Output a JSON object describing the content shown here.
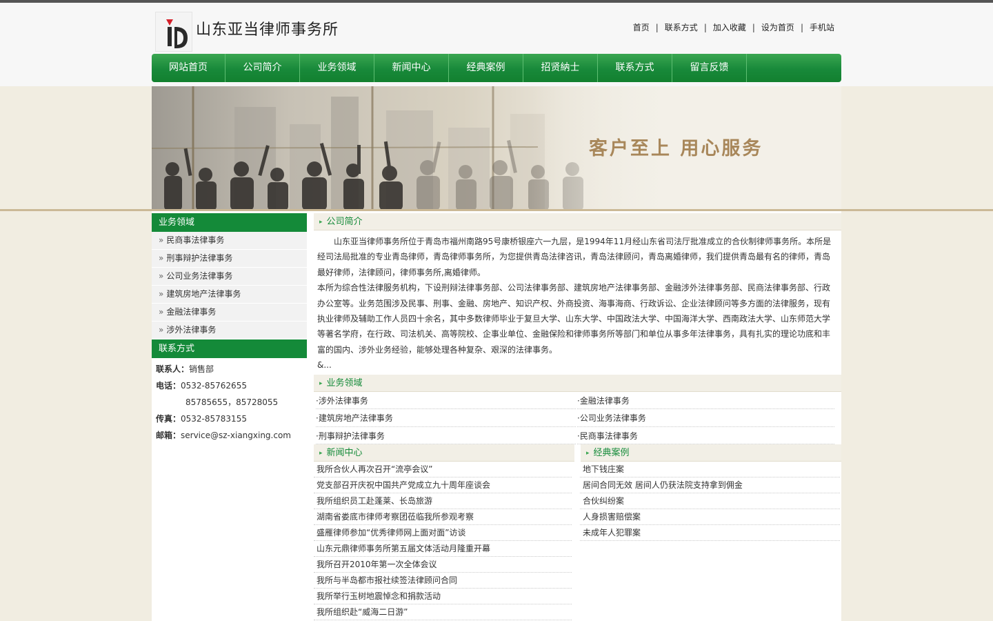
{
  "site": {
    "title": "山东亚当律师事务所",
    "colors": {
      "nav_green": "#148a39",
      "slogan_gold": "#a8875a",
      "page_bg": "#f1ede1"
    }
  },
  "toplinks": [
    "首页",
    "联系方式",
    "加入收藏",
    "设为首页",
    "手机站"
  ],
  "toplinks_sep": "|",
  "nav": [
    "网站首页",
    "公司简介",
    "业务领域",
    "新闻中心",
    "经典案例",
    "招贤納士",
    "联系方式",
    "留言反馈"
  ],
  "banner": {
    "slogan": "客户至上 用心服务"
  },
  "sidebar": {
    "biz_title": "业务领域",
    "arrow": "»",
    "biz_items": [
      "民商事法律事务",
      "刑事辩护法律事务",
      "公司业务法律事务",
      "建筑房地产法律事务",
      "金融法律事务",
      "涉外法律事务"
    ],
    "contact_title": "联系方式",
    "contact": {
      "person_label": "联系人：",
      "person": "销售部",
      "phone_label": "电话：",
      "phone1": "0532-85762655",
      "phone2": "85785655，85728055",
      "fax_label": "传真：",
      "fax": "0532-85783155",
      "email_label": "邮箱：",
      "email": "service@sz-xiangxing.com"
    }
  },
  "about": {
    "title": "公司简介",
    "p1": "山东亚当律师事务所位于青岛市福州南路95号康桥银座六一九层，是1994年11月经山东省司法厅批准成立的合伙制律师事务所。本所是经司法局批准的专业青岛律师，青岛律师事务所，为您提供青岛法律咨讯，青岛法律顾问，青岛离婚律师，我们提供青岛最有名的律师，青岛最好律师，法律顾问，律师事务所,离婚律师。",
    "p2": "本所为综合性法律服务机构，下设刑辩法律事务部、公司法律事务部、建筑房地产法律事务部、金融涉外法律事务部、民商法律事务部、行政办公室等。业务范围涉及民事、刑事、金融、房地产、知识产权、外商投资、海事海商、行政诉讼、企业法律顾问等多方面的法律服务，现有执业律师及辅助工作人员四十余名，其中多数律师毕业于复旦大学、山东大学、中国政法大学、中国海洋大学、西南政法大学、山东师范大学等著名学府，在行政、司法机关、高等院校、企事业单位、金融保险和律师事务所等部门和单位从事多年法律事务，具有扎实的理论功底和丰富的国内、涉外业务经验，能够处理各种复杂、艰深的法律事务。",
    "more": "&..."
  },
  "biz": {
    "title": "业务领域",
    "items": [
      "·涉外法律事务",
      "·金融法律事务",
      "·建筑房地产法律事务",
      "·公司业务法律事务",
      "·刑事辩护法律事务",
      "·民商事法律事务"
    ]
  },
  "news": {
    "title": "新闻中心",
    "items": [
      "我所合伙人再次召开“流亭会议”",
      "党支部召开庆祝中国共产党成立九十周年座谈会",
      "我所组织员工赴蓬莱、长岛旅游",
      "湖南省娄底市律师考察团莅临我所参观考察",
      "盛雁律师参加“优秀律师网上面对面”访谈",
      "山东元鼎律师事务所第五届文体活动月隆重开幕",
      "我所召开2010年第一次全体会议",
      "我所与半岛都市报社续签法律顾问合同",
      "我所举行玉树地震悼念和捐款活动",
      "我所组织赴“威海二日游”"
    ]
  },
  "cases": {
    "title": "经典案例",
    "items": [
      "地下钱庄案",
      "居间合同无效 居间人仍获法院支持拿到佣金",
      "合伙纠纷案",
      "人身损害赔偿案",
      "未成年人犯罪案"
    ]
  }
}
